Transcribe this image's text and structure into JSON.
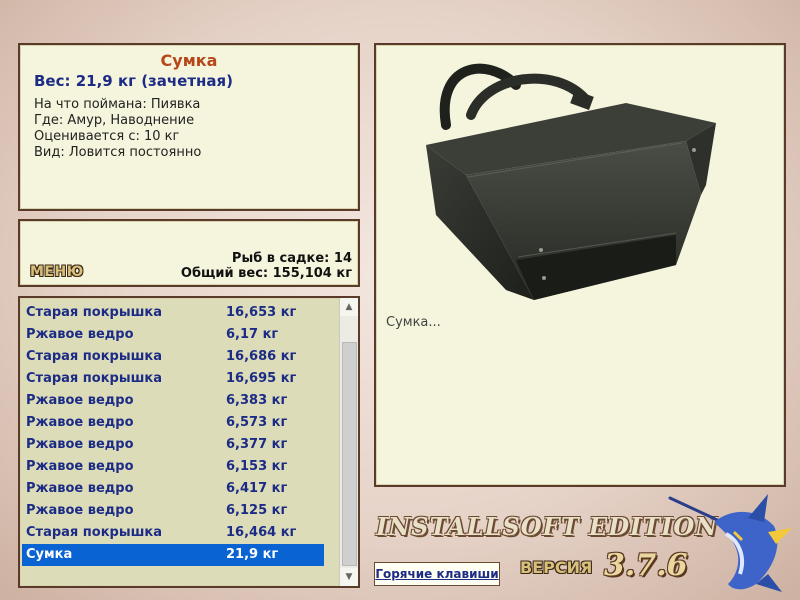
{
  "info": {
    "title": "Сумка",
    "weight": "Вес: 21,9 кг (зачетная)",
    "lines": [
      "На что поймана: Пиявка",
      "Где: Амур, Наводнение",
      "Оценивается с: 10 кг",
      "Вид: Ловится постоянно"
    ]
  },
  "menu": {
    "button_label": "МЕНЮ",
    "fish_in_cage": "Рыб в садке: 14",
    "total_weight": "Общий вес: 155,104 кг"
  },
  "catch_list": [
    {
      "name": "Старая покрышка",
      "weight": "16,653 кг"
    },
    {
      "name": "Ржавое ведро",
      "weight": "6,17 кг"
    },
    {
      "name": "Старая покрышка",
      "weight": "16,686 кг"
    },
    {
      "name": "Старая покрышка",
      "weight": "16,695 кг"
    },
    {
      "name": "Ржавое ведро",
      "weight": "6,383 кг"
    },
    {
      "name": "Ржавое ведро",
      "weight": "6,573 кг"
    },
    {
      "name": "Ржавое ведро",
      "weight": "6,377 кг"
    },
    {
      "name": "Ржавое ведро",
      "weight": "6,153 кг"
    },
    {
      "name": "Ржавое ведро",
      "weight": "6,417 кг"
    },
    {
      "name": "Ржавое ведро",
      "weight": "6,125 кг"
    },
    {
      "name": "Старая покрышка",
      "weight": "16,464 кг"
    },
    {
      "name": "Сумка",
      "weight": "21,9 кг",
      "selected": true
    }
  ],
  "image_panel": {
    "caption": "Сумка..."
  },
  "footer": {
    "hotkeys_label": "Горячие клавиши",
    "edition": "INSTALLSOFT EDITION",
    "version_label": "ВЕРСИЯ",
    "version_number": "3.7.6"
  },
  "colors": {
    "panel_bg": "#f5f4dc",
    "panel_border": "#5a3b2a",
    "title": "#b5471a",
    "accent_text": "#1c2c86",
    "selection": "#0a63d2",
    "list_bg": "#dcdcb8"
  },
  "icons": [
    "scroll-up-arrow-icon",
    "scroll-down-arrow-icon",
    "marlin-logo-icon",
    "bag-picture"
  ]
}
